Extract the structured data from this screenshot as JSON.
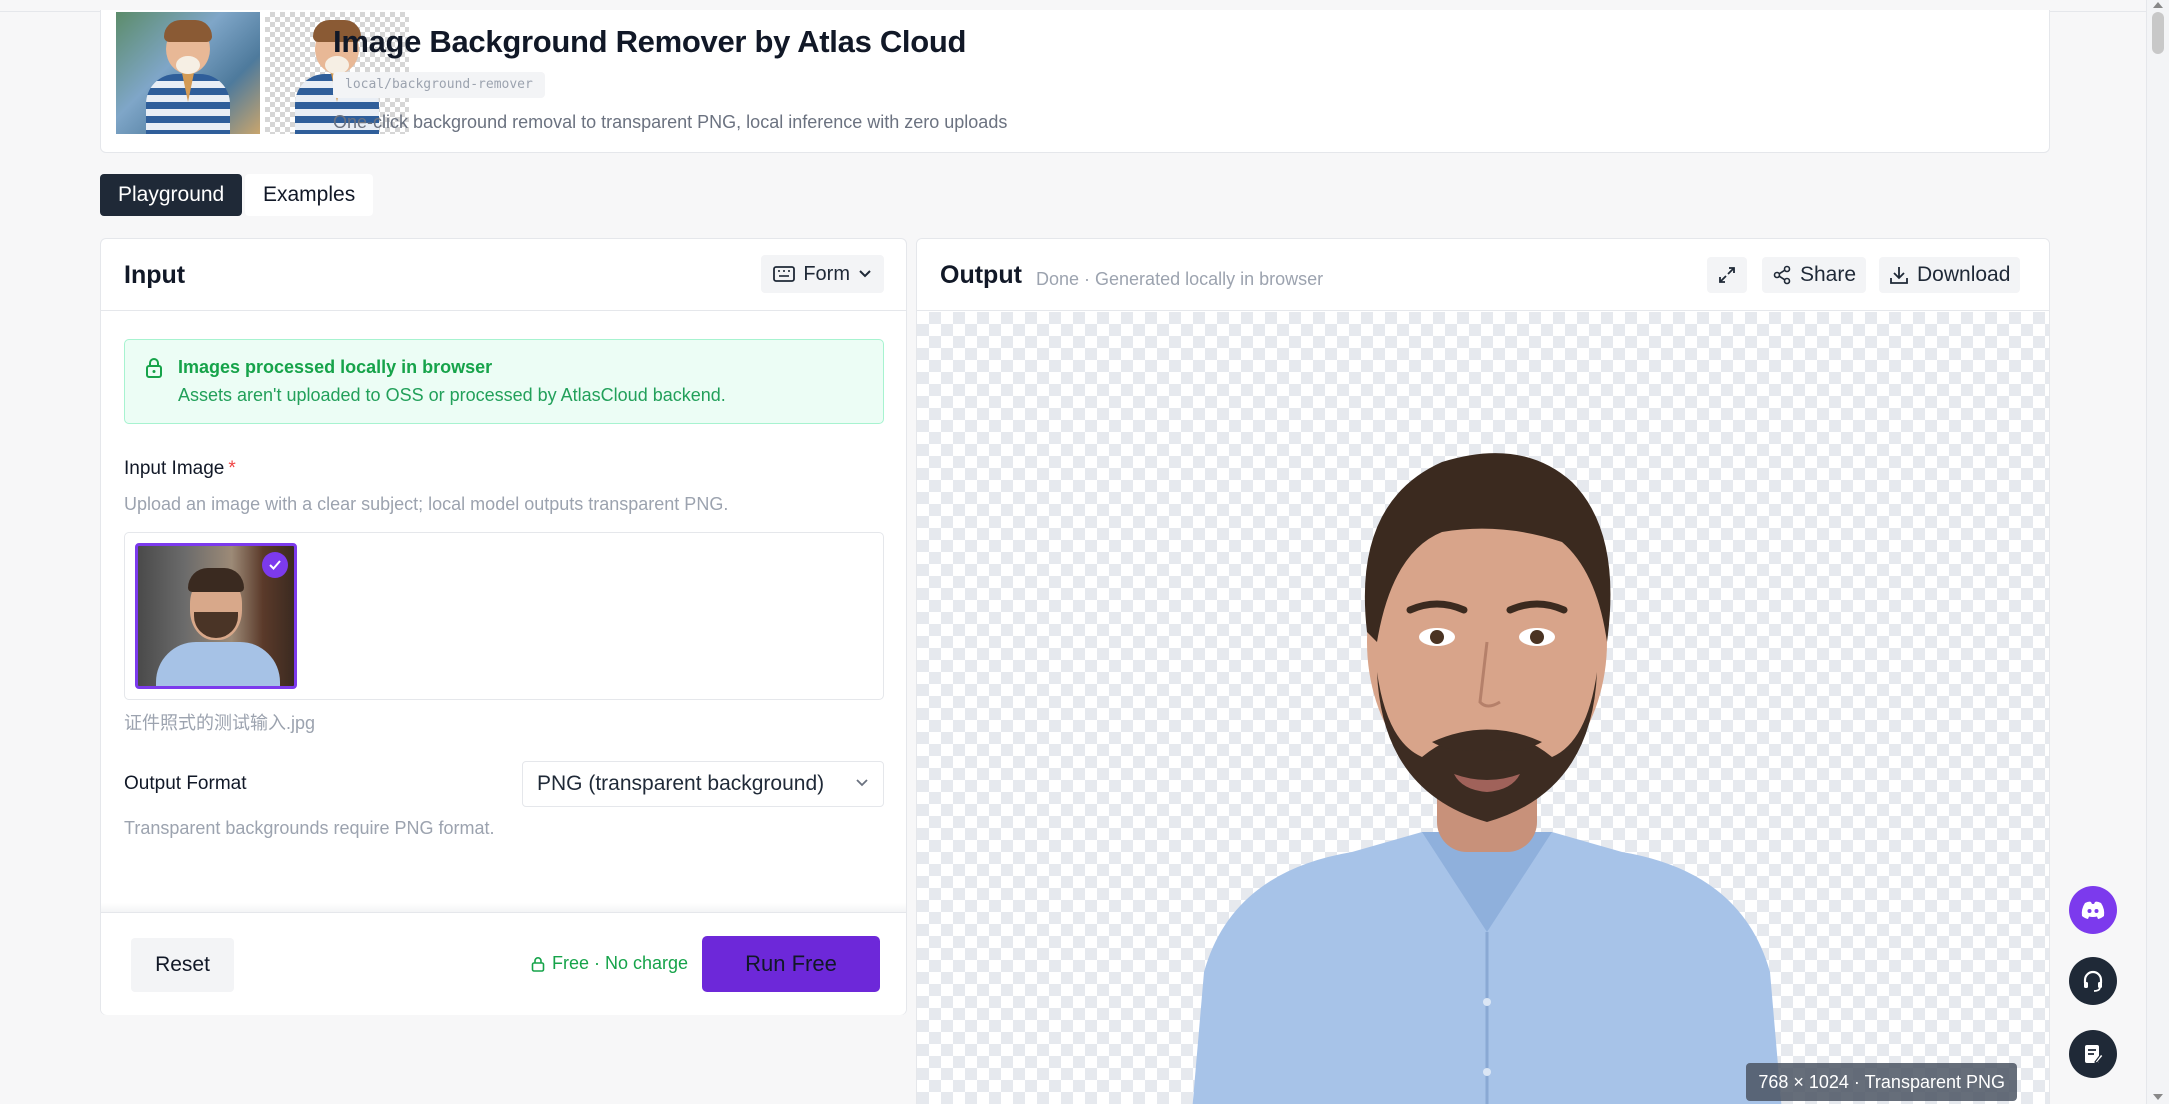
{
  "header": {
    "title": "Image Background Remover by Atlas Cloud",
    "model_id": "local/background-remover",
    "description": "One-click background removal to transparent PNG, local inference with zero uploads"
  },
  "tabs": [
    {
      "label": "Playground",
      "active": true
    },
    {
      "label": "Examples",
      "active": false
    }
  ],
  "input": {
    "title": "Input",
    "mode_label": "Form",
    "notice": {
      "title": "Images processed locally in browser",
      "text": "Assets aren't uploaded to OSS or processed by AtlasCloud backend."
    },
    "image_field": {
      "label": "Input Image",
      "required_mark": "*",
      "hint": "Upload an image with a clear subject; local model outputs transparent PNG.",
      "file_name": "证件照式的测试输入.jpg"
    },
    "format_field": {
      "label": "Output Format",
      "value": "PNG (transparent background)",
      "hint": "Transparent backgrounds require PNG format."
    },
    "footer": {
      "reset_label": "Reset",
      "free_label": "Free · No charge",
      "run_label": "Run Free"
    }
  },
  "output": {
    "title": "Output",
    "status": "Done · Generated locally in browser",
    "share_label": "Share",
    "download_label": "Download",
    "resolution": "768 × 1024 · Transparent PNG"
  },
  "colors": {
    "accent": "#6d28d9",
    "success": "#16a34a",
    "dark": "#1f2937"
  },
  "icons": [
    "lock-icon",
    "keyboard-icon",
    "chevron-down-icon",
    "check-icon",
    "expand-icon",
    "share-icon",
    "download-icon",
    "discord-icon",
    "headset-icon",
    "notes-icon"
  ]
}
